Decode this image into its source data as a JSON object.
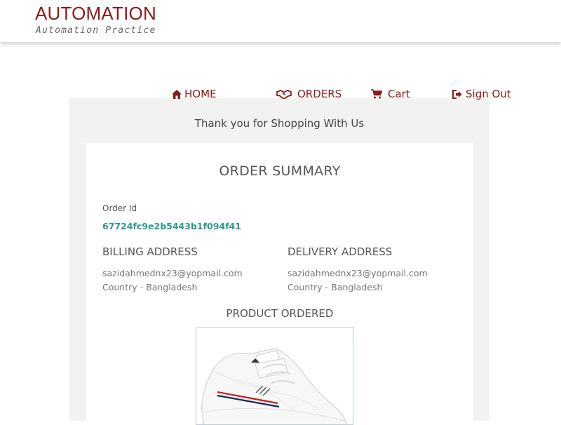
{
  "header": {
    "title": "AUTOMATION",
    "subtitle": "Automation Practice"
  },
  "nav": {
    "home": "HOME",
    "orders": "ORDERS",
    "cart": "Cart",
    "signout": "Sign Out"
  },
  "colors": {
    "brand": "#8b1a1a",
    "accent": "#2b9a8f",
    "panel_bg": "#f2f2f2"
  },
  "thank_you": "Thank you for Shopping With Us",
  "summary": {
    "title": "ORDER SUMMARY",
    "order_id_label": "Order Id",
    "order_id": "67724fc9e2b5443b1f094f41",
    "billing": {
      "heading": "BILLING ADDRESS",
      "email": "sazidahmednx23@yopmail.com",
      "country": "Country - Bangladesh"
    },
    "delivery": {
      "heading": "DELIVERY ADDRESS",
      "email": "sazidahmednx23@yopmail.com",
      "country": "Country - Bangladesh"
    },
    "product_heading": "PRODUCT ORDERED"
  }
}
